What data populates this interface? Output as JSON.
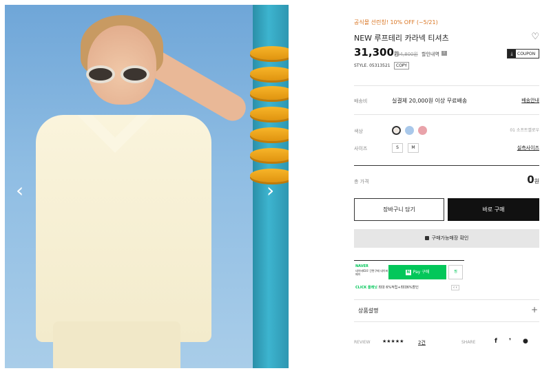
{
  "product": {
    "promo": "공식몰 선런칭! 10% OFF (~5/21)",
    "title": "NEW 루프테리 카라넥 티셔츠",
    "price": "31,300",
    "price_unit": "원",
    "old_price": "34,800원",
    "discount_info": "할인내역",
    "coupon_label": "COUPON",
    "style_code": "STYLE. 05313521",
    "copy_label": "COPY"
  },
  "shipping": {
    "label": "배송비",
    "value": "실결제 20,000원 이상 무료배송",
    "link": "배송안내"
  },
  "options": {
    "color_label": "색상",
    "color_selected": "01 소프트옐로우",
    "colors": [
      "#efe6de",
      "#a9c8ea",
      "#e9a3aa"
    ],
    "size_label": "사이즈",
    "sizes": [
      "S",
      "M"
    ],
    "size_link": "실측사이즈"
  },
  "total": {
    "label": "총 가격",
    "value": "0",
    "unit": "원"
  },
  "buttons": {
    "cart": "장바구니 담기",
    "buy": "바로 구매",
    "store": "구매가능매장 확인"
  },
  "npay": {
    "brand": "NAVER",
    "sub": "네이버ID로 간편구매 네이버페이",
    "button": "Pay 구매",
    "button_n": "N",
    "wish": "찜",
    "event_brand": "CLICK 플래닛",
    "event_text": "최대 6%적립+최대6%할인",
    "pager": "‹ ›"
  },
  "sections": {
    "description": "상품설명",
    "plus": "+"
  },
  "review": {
    "label": "REVIEW",
    "stars": "★★★★★",
    "count": "2건",
    "share_label": "SHARE",
    "share_icons": [
      "f",
      "❜",
      "●"
    ]
  },
  "gallery": {
    "prev": "‹",
    "next": "›"
  }
}
